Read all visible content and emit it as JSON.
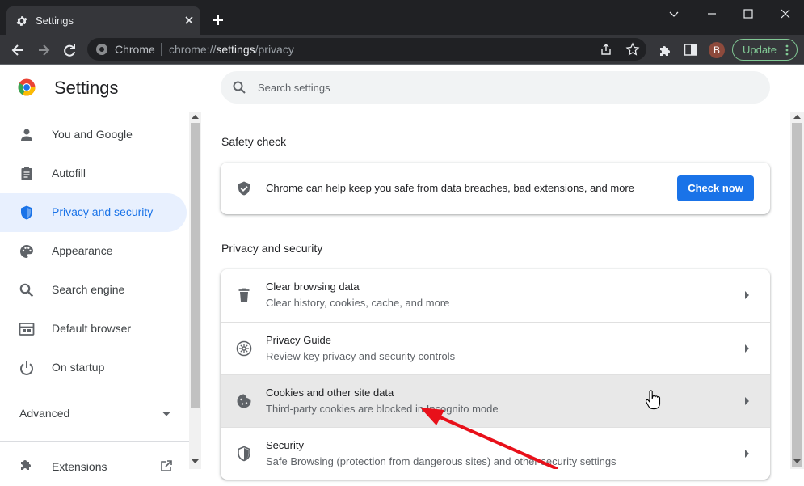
{
  "window": {
    "tab_title": "Settings",
    "tab_icon": "gear-icon"
  },
  "toolbar": {
    "site_label": "Chrome",
    "url_scheme": "chrome://",
    "url_host": "settings",
    "url_path": "/privacy",
    "avatar_letter": "B",
    "update_label": "Update"
  },
  "header": {
    "title": "Settings",
    "search_placeholder": "Search settings"
  },
  "sidebar": {
    "items": [
      {
        "label": "You and Google",
        "icon": "person-icon"
      },
      {
        "label": "Autofill",
        "icon": "clipboard-icon"
      },
      {
        "label": "Privacy and security",
        "icon": "shield-icon",
        "active": true
      },
      {
        "label": "Appearance",
        "icon": "palette-icon"
      },
      {
        "label": "Search engine",
        "icon": "search-icon"
      },
      {
        "label": "Default browser",
        "icon": "browser-window-icon"
      },
      {
        "label": "On startup",
        "icon": "power-icon"
      }
    ],
    "advanced_label": "Advanced",
    "extensions_label": "Extensions"
  },
  "safety_check": {
    "section_title": "Safety check",
    "message": "Chrome can help keep you safe from data breaches, bad extensions, and more",
    "button_label": "Check now"
  },
  "privacy": {
    "section_title": "Privacy and security",
    "rows": [
      {
        "title": "Clear browsing data",
        "subtitle": "Clear history, cookies, cache, and more",
        "icon": "trash-icon"
      },
      {
        "title": "Privacy Guide",
        "subtitle": "Review key privacy and security controls",
        "icon": "compass-icon"
      },
      {
        "title": "Cookies and other site data",
        "subtitle": "Third-party cookies are blocked in Incognito mode",
        "icon": "cookie-icon",
        "hovered": true
      },
      {
        "title": "Security",
        "subtitle": "Safe Browsing (protection from dangerous sites) and other security settings",
        "icon": "shield-icon"
      }
    ]
  },
  "colors": {
    "accent": "#1a73e8",
    "active_nav_bg": "#e8f0fe",
    "annotation_arrow": "#e8101a",
    "frame_dark": "#202124",
    "toolbar": "#35363a"
  }
}
